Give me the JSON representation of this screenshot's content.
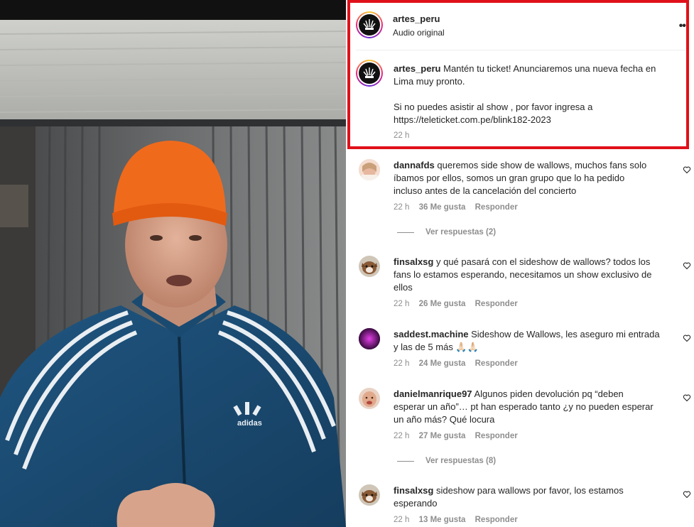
{
  "post": {
    "author": "artes_peru",
    "audio": "Audio original",
    "more_icon": "••"
  },
  "caption": {
    "username": "artes_peru",
    "line1": "Mantén tu ticket! Anunciaremos una nueva fecha en",
    "line2": "Lima muy pronto.",
    "line3": "Si no puedes asistir al show , por favor ingresa a",
    "line4": "https://teleticket.com.pe/blink182-2023",
    "time": "22 h"
  },
  "comments": [
    {
      "username": "dannafds",
      "lines": [
        "queremos side show de wallows, muchos fans solo",
        "íbamos por ellos, somos un gran grupo que lo ha pedido",
        "incluso antes de la cancelación del concierto"
      ],
      "time": "22 h",
      "likes": "36 Me gusta",
      "reply": "Responder",
      "view_replies": "Ver respuestas (2)"
    },
    {
      "username": "finsalxsg",
      "lines": [
        "y qué pasará con el sideshow de wallows? todos los",
        "fans lo estamos esperando, necesitamos un show exclusivo de",
        "ellos"
      ],
      "time": "22 h",
      "likes": "26 Me gusta",
      "reply": "Responder"
    },
    {
      "username": "saddest.machine",
      "lines": [
        "Sideshow de Wallows, les aseguro mi entrada",
        "y las de 5 más 🙏🏻🙏🏻"
      ],
      "time": "22 h",
      "likes": "24 Me gusta",
      "reply": "Responder"
    },
    {
      "username": "danielmanrique97",
      "lines": [
        "Algunos piden devolución pq “deben",
        "esperar un año”… pt han esperado tanto ¿y no pueden esperar",
        "un año más? Qué locura"
      ],
      "time": "22 h",
      "likes": "27 Me gusta",
      "reply": "Responder",
      "view_replies": "Ver respuestas (8)"
    },
    {
      "username": "finsalxsg",
      "lines": [
        "sideshow para wallows por favor, los estamos",
        "esperando"
      ],
      "time": "22 h",
      "likes": "13 Me gusta",
      "reply": "Responder"
    }
  ],
  "video": {
    "shirt_brand": "adidas"
  },
  "colors": {
    "highlight": "#e0101a",
    "muted": "#8e8e8e",
    "text": "#262626"
  }
}
